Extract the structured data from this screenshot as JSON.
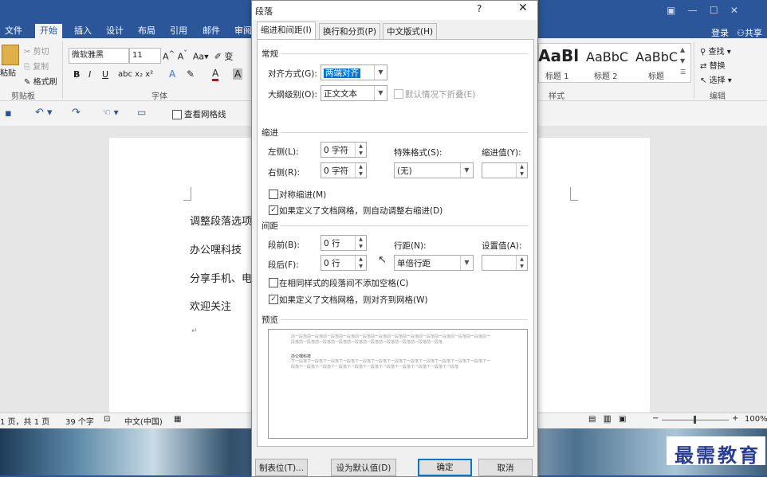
{
  "ribbon": {
    "tabs": [
      "文件",
      "开始",
      "插入",
      "设计",
      "布局",
      "引用",
      "邮件",
      "审阅"
    ],
    "right_signin": "登录",
    "right_share": "共享",
    "clipboard": {
      "paste": "粘贴",
      "cut": "剪切",
      "copy": "复制",
      "format_painter": "格式刷",
      "group": "剪贴板"
    },
    "font": {
      "name": "微软雅黑",
      "size": "11",
      "group": "字体"
    },
    "styles": {
      "samples": [
        "AaBl",
        "AaBbC",
        "AaBbC"
      ],
      "names": [
        "标题 1",
        "标题 2",
        "标题"
      ],
      "group": "样式"
    },
    "editing": {
      "find": "查找",
      "replace": "替换",
      "select": "选择",
      "group": "编辑"
    }
  },
  "qat": {
    "gridlines_label": "查看网格线"
  },
  "document": {
    "lines": [
      "调整段落选项",
      "办公嘿科技",
      "分享手机、电",
      "欢迎关注"
    ],
    "return_mark": "↵"
  },
  "status": {
    "page": "1 页，共 1 页",
    "words": "39 个字",
    "lang": "中文(中国)",
    "zoom": "100%"
  },
  "watermark": "最需教育",
  "dialog": {
    "title": "段落",
    "help": "?",
    "tabs": [
      "缩进和间距(I)",
      "换行和分页(P)",
      "中文版式(H)"
    ],
    "general": {
      "section": "常规",
      "align_label": "对齐方式(G):",
      "align_value": "两端对齐",
      "outline_label": "大纲级别(O):",
      "outline_value": "正文文本",
      "collapse_label": "默认情况下折叠(E)"
    },
    "indent": {
      "section": "缩进",
      "left_label": "左侧(L):",
      "left_value": "0 字符",
      "right_label": "右侧(R):",
      "right_value": "0 字符",
      "special_label": "特殊格式(S):",
      "special_value": "(无)",
      "by_label": "缩进值(Y):",
      "mirror_label": "对称缩进(M)",
      "auto_label": "如果定义了文档网格，则自动调整右缩进(D)"
    },
    "spacing": {
      "section": "间距",
      "before_label": "段前(B):",
      "before_value": "0 行",
      "after_label": "段后(F):",
      "after_value": "0 行",
      "line_label": "行距(N):",
      "line_value": "单倍行距",
      "at_label": "设置值(A):",
      "no_space_label": "在相同样式的段落间不添加空格(C)",
      "snap_label": "如果定义了文档网格，则对齐到网格(W)"
    },
    "preview": {
      "section": "预览",
      "prev_text": "前一段落前一段落前一段落前一段落前一段落前一段落前一段落前一段落前一段落前一段落前一段落前一段落前一段落前一段落前一段落前一段落前一段落前一段落前一段落前一段落前一段落前一段落",
      "sample": "办公嘿科技",
      "next_text": "下一段落下一段落下一段落下一段落下一段落下一段落下一段落下一段落下一段落下一段落下一段落下一段落下一段落下一段落下一段落下一段落下一段落下一段落下一段落下一段落下一段落下一段落下一段落"
    },
    "buttons": {
      "tabs": "制表位(T)...",
      "default": "设为默认值(D)",
      "ok": "确定",
      "cancel": "取消"
    }
  }
}
